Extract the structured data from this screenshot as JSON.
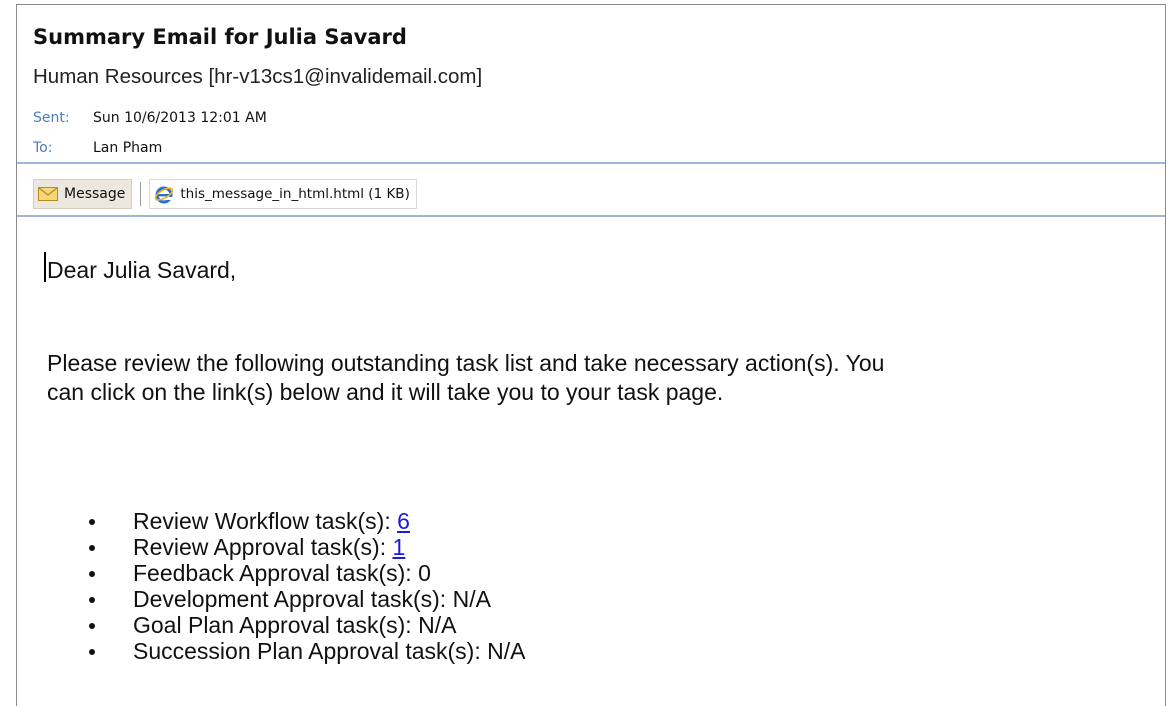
{
  "email": {
    "subject": "Summary Email for Julia Savard",
    "from": "Human Resources [hr-v13cs1@invalidemail.com]",
    "sent_label": "Sent:",
    "sent_value": "Sun 10/6/2013 12:01 AM",
    "to_label": "To:",
    "to_value": "Lan Pham"
  },
  "attachments": {
    "message_label": "Message",
    "file_label": "this_message_in_html.html (1 KB)"
  },
  "body": {
    "greeting": "Dear Julia Savard,",
    "intro_line1": "Please review the following outstanding task list and take necessary action(s). You",
    "intro_line2": "can click on the link(s) below and it will take you to your task page.",
    "tasks": [
      {
        "label": "Review Workflow task(s): ",
        "value": "6",
        "link": true
      },
      {
        "label": "Review Approval task(s): ",
        "value": "1",
        "link": true
      },
      {
        "label": "Feedback Approval task(s): ",
        "value": "0",
        "link": false
      },
      {
        "label": "Development Approval task(s): ",
        "value": "N/A",
        "link": false
      },
      {
        "label": "Goal Plan Approval task(s): ",
        "value": "N/A",
        "link": false
      },
      {
        "label": "Succession Plan Approval task(s): ",
        "value": "N/A",
        "link": false
      }
    ]
  },
  "icons": {
    "message": "envelope-icon",
    "file": "internet-explorer-icon"
  },
  "colors": {
    "header_label": "#4a7fbf",
    "separator": "#9db7dc",
    "link": "#1a1adb"
  }
}
